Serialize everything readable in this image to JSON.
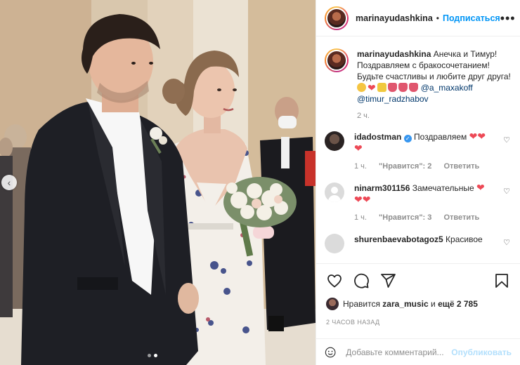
{
  "post": {
    "author": "marinayudashkina",
    "follow_label": "Подписаться",
    "more_label": "•••",
    "caption_lines": [
      "Анечка и Тимур!",
      "Поздравляем с бракосочетанием!",
      "Будьте счастливы и любите друг друга!"
    ],
    "mentions": [
      "@a_maxakoff",
      "@timur_radzhabov"
    ],
    "caption_time": "2 ч."
  },
  "comments": [
    {
      "user": "idadostman",
      "verified": true,
      "text": "Поздравляем",
      "time": "1 ч.",
      "likes": "\"Нравится\": 2",
      "reply": "Ответить"
    },
    {
      "user": "ninarm301156",
      "verified": false,
      "text": "Замечательные",
      "time": "1 ч.",
      "likes": "\"Нравится\": 3",
      "reply": "Ответить"
    },
    {
      "user": "shurenbaevabotagoz5",
      "verified": false,
      "text": "Красивое",
      "time": "",
      "likes": "",
      "reply": ""
    }
  ],
  "likes": {
    "prefix": "Нравится",
    "user": "zara_music",
    "conj": "и",
    "more": "ещё 2 785"
  },
  "timestamp": "2 ЧАСОВ НАЗАД",
  "add_comment": {
    "placeholder": "Добавьте комментарий...",
    "publish_label": "Опубликовать"
  },
  "carousel": {
    "prev_icon": "chevron-left-icon",
    "slides": 2,
    "active": 2
  },
  "colors": {
    "link": "#0095f6",
    "mention": "#00376b",
    "heart": "#ed4956",
    "muted": "#8e8e8e",
    "publish_disabled": "#b2dffc"
  }
}
